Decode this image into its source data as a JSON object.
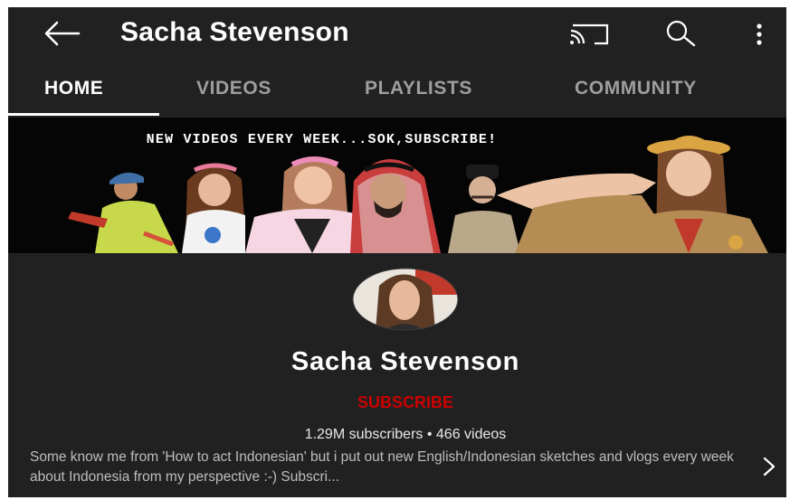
{
  "header": {
    "title": "Sacha Stevenson",
    "icons": [
      "back-arrow-icon",
      "cast-icon",
      "search-icon",
      "more-vert-icon"
    ]
  },
  "tabs": [
    {
      "label": "HOME",
      "active": true
    },
    {
      "label": "VIDEOS",
      "active": false
    },
    {
      "label": "PLAYLISTS",
      "active": false
    },
    {
      "label": "COMMUNITY",
      "active": false
    }
  ],
  "banner": {
    "text": "NEW VIDEOS EVERY WEEK...SOK,SUBSCRIBE!"
  },
  "channel": {
    "name": "Sacha Stevenson",
    "subscribe_label": "SUBSCRIBE",
    "stats": "1.29M subscribers • 466 videos",
    "description": "Some know me from 'How to act Indonesian' but i put out new English/Indonesian sketches and vlogs every week about Indonesia from my perspective :-) Subscri..."
  },
  "colors": {
    "background": "#212121",
    "subscribe": "#cc0000",
    "text_primary": "#ffffff",
    "tab_inactive": "#9e9e9e"
  }
}
